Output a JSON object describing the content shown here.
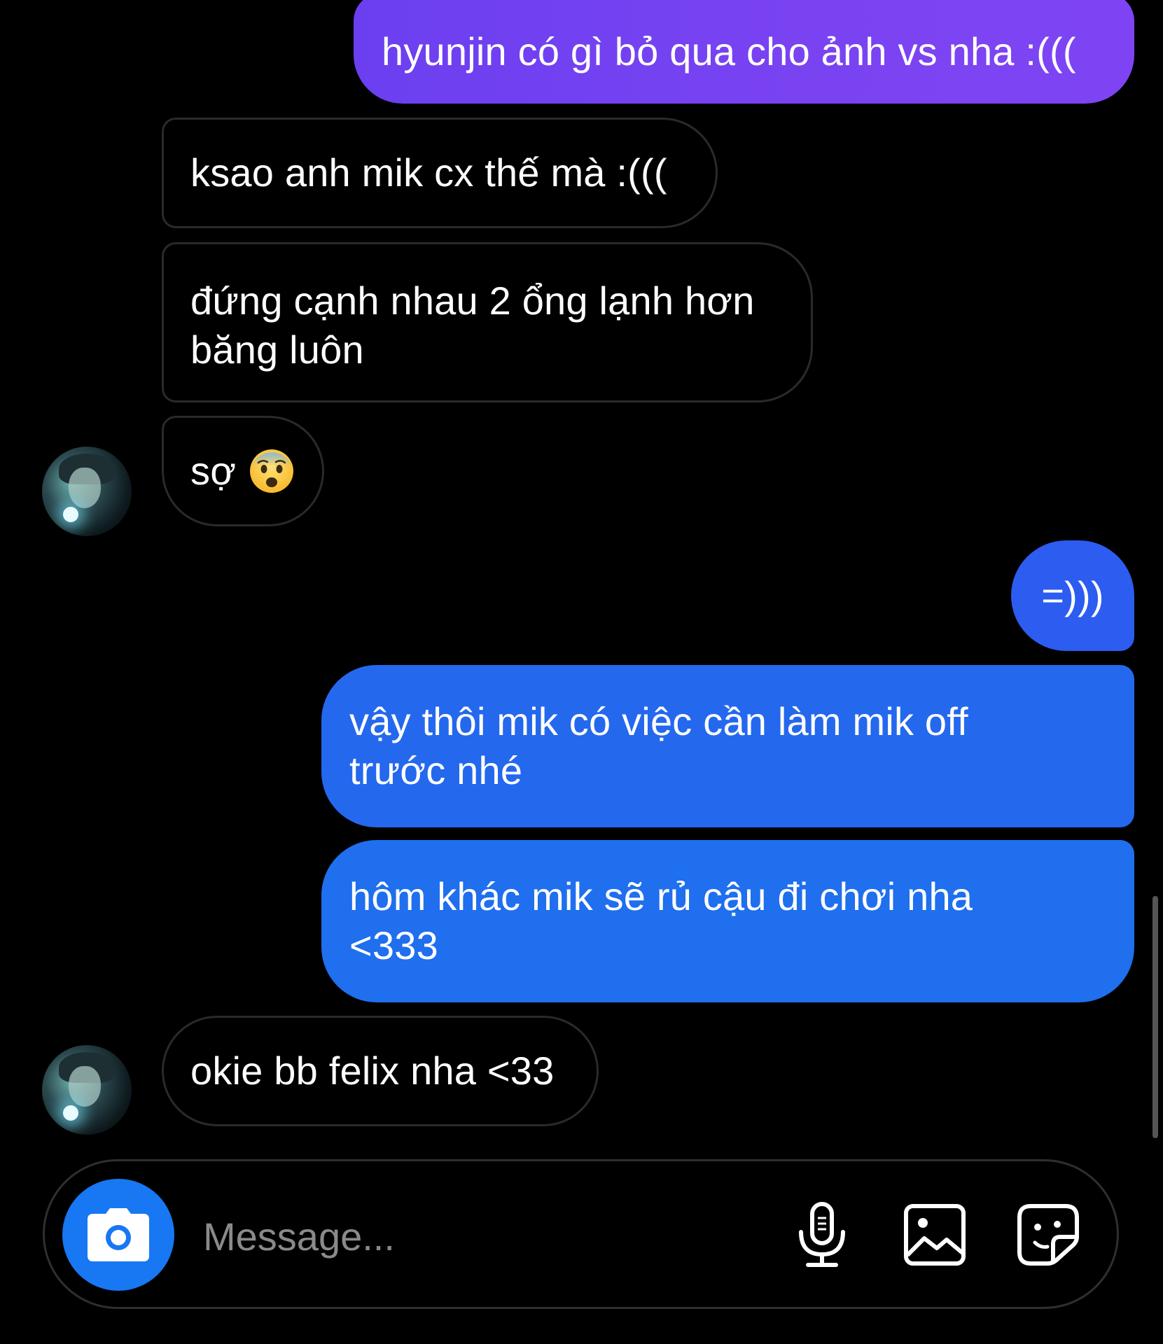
{
  "colors": {
    "background": "#000000",
    "incoming_border": "#2a2a2a",
    "outgoing_purple": "#6b3ff0",
    "outgoing_blue": "#1f6df2",
    "camera_button": "#1877f2",
    "placeholder": "#8a8a8a"
  },
  "messages": [
    {
      "direction": "outgoing",
      "text": "hyunjin có gì bỏ qua cho ảnh vs nha :((("
    },
    {
      "direction": "incoming",
      "text": "ksao anh mik cx thế mà :((("
    },
    {
      "direction": "incoming",
      "line1": "đứng cạnh nhau 2 ổng lạnh hơn",
      "line2": "băng luôn"
    },
    {
      "direction": "incoming",
      "text": "sợ",
      "emoji": "fearful-face-emoji",
      "avatar": "hyunjin-avatar"
    },
    {
      "direction": "outgoing",
      "text": "=)))"
    },
    {
      "direction": "outgoing",
      "line1": "vậy thôi mik có việc cần làm mik off",
      "line2": "trước nhé"
    },
    {
      "direction": "outgoing",
      "line1": "hôm khác mik sẽ rủ cậu đi chơi nha",
      "line2": "<333"
    },
    {
      "direction": "incoming",
      "text": "okie bb felix nha <33",
      "avatar": "hyunjin-avatar"
    }
  ],
  "composer": {
    "placeholder": "Message...",
    "icons": [
      "camera-icon",
      "microphone-icon",
      "gallery-icon",
      "sticker-icon"
    ]
  }
}
